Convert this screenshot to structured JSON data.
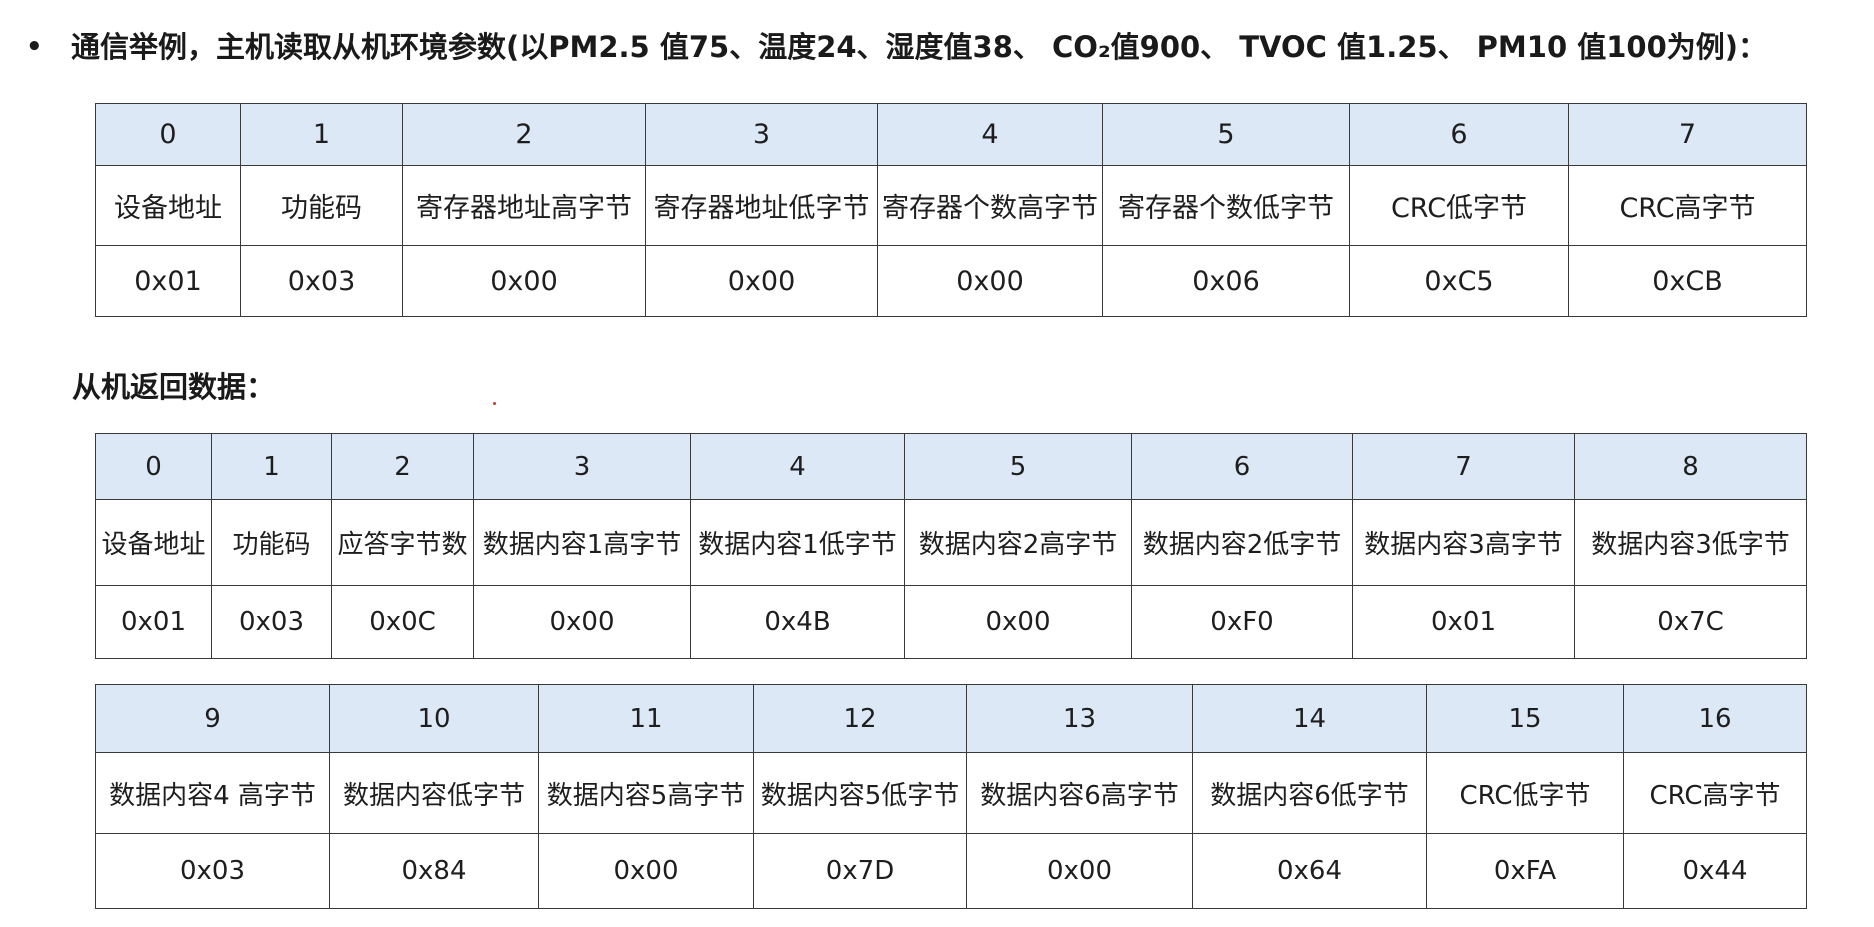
{
  "bullet": "•",
  "heading": "通信举例，主机读取从机环境参数(以PM2.5 值75、温度24、湿度值38、 CO₂值900、 TVOC 值1.25、 PM10 值100为例)：",
  "request_table": {
    "indices": [
      "0",
      "1",
      "2",
      "3",
      "4",
      "5",
      "6",
      "7"
    ],
    "names": [
      "设备地址",
      "功能码",
      "寄存器地址高字节",
      "寄存器地址低字节",
      "寄存器个数高字节",
      "寄存器个数低字节",
      "CRC低字节",
      "CRC高字节"
    ],
    "values": [
      "0x01",
      "0x03",
      "0x00",
      "0x00",
      "0x00",
      "0x06",
      "0xC5",
      "0xCB"
    ]
  },
  "response_heading": "从机返回数据：",
  "response_table_1": {
    "indices": [
      "0",
      "1",
      "2",
      "3",
      "4",
      "5",
      "6",
      "7",
      "8"
    ],
    "names": [
      "设备地址",
      "功能码",
      "应答字节数",
      "数据内容1高字节",
      "数据内容1低字节",
      "数据内容2高字节",
      "数据内容2低字节",
      "数据内容3高字节",
      "数据内容3低字节"
    ],
    "values": [
      "0x01",
      "0x03",
      "0x0C",
      "0x00",
      "0x4B",
      "0x00",
      "0xF0",
      "0x01",
      "0x7C"
    ]
  },
  "response_table_2": {
    "indices": [
      "9",
      "10",
      "11",
      "12",
      "13",
      "14",
      "15",
      "16"
    ],
    "names": [
      "数据内容4 高字节",
      "数据内容低字节",
      "数据内容5高字节",
      "数据内容5低字节",
      "数据内容6高字节",
      "数据内容6低字节",
      "CRC低字节",
      "CRC高字节"
    ],
    "values": [
      "0x03",
      "0x84",
      "0x00",
      "0x7D",
      "0x00",
      "0x64",
      "0xFA",
      "0x44"
    ]
  },
  "colors": {
    "header_fill": "#dce8f5",
    "border": "#3a3a3a",
    "text": "#1a1a1a"
  }
}
